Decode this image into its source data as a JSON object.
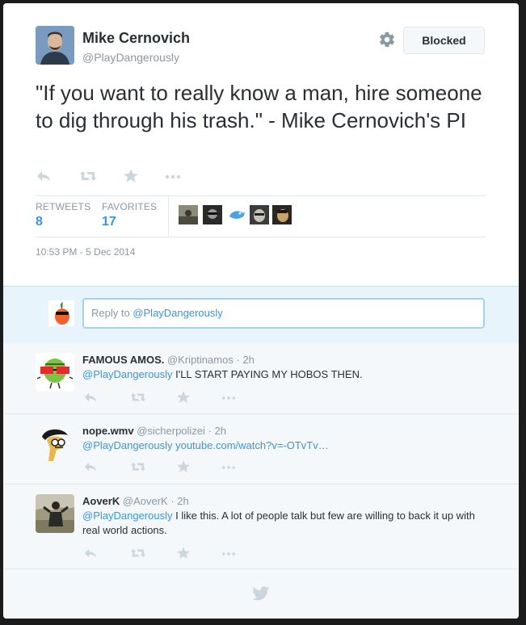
{
  "tweet": {
    "author_name": "Mike Cernovich",
    "author_handle": "@PlayDangerously",
    "blocked_label": "Blocked",
    "text": "\"If you want to really know a man, hire someone to dig through his trash.\" - Mike Cernovich's PI",
    "retweets_label": "RETWEETS",
    "retweets_count": "8",
    "favorites_label": "FAVORITES",
    "favorites_count": "17",
    "timestamp": "10:53 PM - 5 Dec 2014"
  },
  "reply_box": {
    "prefix": "Reply to ",
    "mention": "@PlayDangerously"
  },
  "replies": [
    {
      "name": "FAMOUS AMOS.",
      "handle": "@Kriptinamos",
      "time": "· 2h",
      "mention": "@PlayDangerously",
      "text": " I'LL START PAYING MY HOBOS THEN."
    },
    {
      "name": "nope.wmv",
      "handle": "@sicherpolizei",
      "time": "· 2h",
      "mention": "@PlayDangerously",
      "link": " youtube.com/watch?v=-OTvTv…"
    },
    {
      "name": "AoverK",
      "handle": "@AoverK",
      "time": "· 2h",
      "mention": "@PlayDangerously",
      "text": " I like this. A lot of people talk but few are willing to back it up with real world actions."
    }
  ],
  "colors": {
    "accent": "#3b94d9",
    "muted": "#8899a6",
    "reply_bg": "#e8f4fb",
    "icon": "#ccd6dd"
  },
  "icons": {
    "reply": "reply-icon",
    "retweet": "retweet-icon",
    "favorite": "star-icon",
    "more": "more-icon",
    "settings": "gear-icon",
    "twitter": "twitter-bird-icon"
  }
}
